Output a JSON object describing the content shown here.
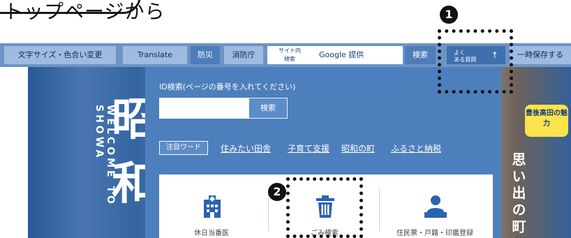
{
  "guide": {
    "title": "トップページから"
  },
  "toolbar": {
    "text_size": "文字サイズ・色合い変更",
    "translate": "Translate",
    "disaster": "防災",
    "hazard": "消防庁",
    "site_search_line1": "サイト内",
    "site_search_line2": "検索",
    "google_search": "Google 提供",
    "search_button": "検索",
    "often_line1": "よく",
    "often_line2": "ある質問",
    "often_arrow": "↑",
    "save": "一時保存する"
  },
  "id_search": {
    "label": "ID検索(ページの番号を入れてください)",
    "input_value": "",
    "button": "検索"
  },
  "keywords": {
    "badge": "注目ワード",
    "links": [
      "住みたい田舎",
      "子育て支援",
      "昭和の町",
      "ふるさと納税"
    ]
  },
  "cards": [
    {
      "label": "休日当番医",
      "icon": "hospital-icon"
    },
    {
      "label": "ごみ検索",
      "icon": "trash-icon"
    },
    {
      "label": "住民票・戸籍・印鑑登録",
      "icon": "person-counter-icon"
    }
  ],
  "photo": {
    "vertical_text": "WELCOME TO SHOWA",
    "big_char_1": "昭",
    "big_char_2": "和",
    "right_vertical": "思い出の町",
    "badge": "豊後高田の魅力"
  },
  "annotations": {
    "marker_1": "1",
    "marker_2": "2"
  },
  "colors": {
    "toolbar": "#6c94c6",
    "panel": "#4e7fbd",
    "button": "#9ebbe0",
    "dots": "#111111"
  }
}
